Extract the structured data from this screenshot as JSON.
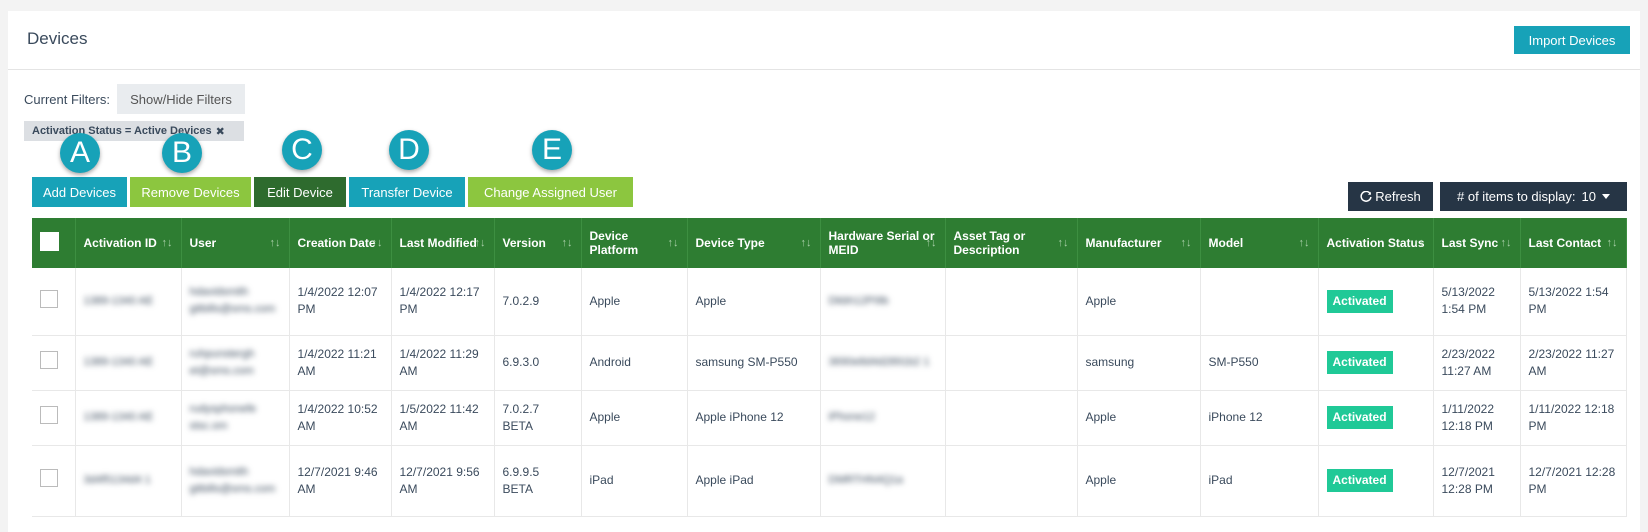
{
  "header": {
    "title": "Devices",
    "import_label": "Import Devices"
  },
  "filters": {
    "label": "Current Filters:",
    "toggle_label": "Show/Hide Filters",
    "active_filter": "Activation Status = Active Devices",
    "remove_glyph": "✖"
  },
  "actions": [
    {
      "label": "Add Devices",
      "color": "#17a2b8"
    },
    {
      "label": "Remove Devices",
      "color": "#8cc63f"
    },
    {
      "label": "Edit Device",
      "color": "#2e6b2e"
    },
    {
      "label": "Transfer Device",
      "color": "#17a2b8"
    },
    {
      "label": "Change Assigned User",
      "color": "#8cc63f"
    }
  ],
  "callouts": [
    "A",
    "B",
    "C",
    "D",
    "E"
  ],
  "toolbar": {
    "refresh_icon": "refresh-icon",
    "refresh_label": "Refresh",
    "items_label": "# of items to display:",
    "items_value": "10"
  },
  "table": {
    "sort_glyph": "↑↓",
    "columns": [
      "Activation ID",
      "User",
      "Creation Date",
      "Last Modified",
      "Version",
      "Device Platform",
      "Device Type",
      "Hardware Serial or MEID",
      "Asset Tag or Description",
      "Manufacturer",
      "Model",
      "Activation Status",
      "Last Sync",
      "Last Contact"
    ],
    "rows": [
      {
        "activation_id": "1389-1340 AE",
        "user": "hdavidsmith gitbills@sms.com",
        "creation_date": "1/4/2022 12:07 PM",
        "last_modified": "1/4/2022 12:17 PM",
        "version": "7.0.2.9",
        "platform": "Apple",
        "device_type": "Apple",
        "serial": "Dkbh12Pi9b",
        "asset_tag": "",
        "manufacturer": "Apple",
        "model": "",
        "status": "Activated",
        "last_sync": "5/13/2022 1:54 PM",
        "last_contact": "5/13/2022 1:54 PM"
      },
      {
        "activation_id": "1389-1340 AE",
        "user": "ruhpunstergh et@sms.com",
        "creation_date": "1/4/2022 11:21 AM",
        "last_modified": "1/4/2022 11:29 AM",
        "version": "6.9.3.0",
        "platform": "Android",
        "device_type": "samsung SM-P550",
        "serial": "3690e8d4d2891b2 1",
        "asset_tag": "",
        "manufacturer": "samsung",
        "model": "SM-P550",
        "status": "Activated",
        "last_sync": "2/23/2022 11:27 AM",
        "last_contact": "2/23/2022 11:27 AM"
      },
      {
        "activation_id": "1389-1340 AE",
        "user": "rudysphonefe stsc.om",
        "creation_date": "1/4/2022 10:52 AM",
        "last_modified": "1/5/2022 11:42 AM",
        "version": "7.0.2.7 BETA",
        "platform": "Apple",
        "device_type": "Apple iPhone 12",
        "serial": "iPhone12",
        "asset_tag": "",
        "manufacturer": "Apple",
        "model": "iPhone 12",
        "status": "Activated",
        "last_sync": "1/11/2022 12:18 PM",
        "last_contact": "1/11/2022 12:18 PM"
      },
      {
        "activation_id": "3d4f5134d4 1",
        "user": "hdavidsmith gitbills@sms.com",
        "creation_date": "12/7/2021 9:46 AM",
        "last_modified": "12/7/2021 9:56 AM",
        "version": "6.9.9.5 BETA",
        "platform": "iPad",
        "device_type": "Apple iPad",
        "serial": "DMRTHN4Q1a",
        "asset_tag": "",
        "manufacturer": "Apple",
        "model": "iPad",
        "status": "Activated",
        "last_sync": "12/7/2021 12:28 PM",
        "last_contact": "12/7/2021 12:28 PM"
      }
    ]
  }
}
